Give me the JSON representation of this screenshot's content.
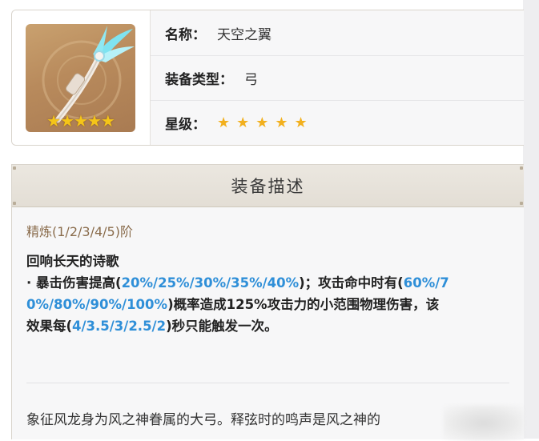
{
  "item": {
    "name_label": "名称：",
    "name_value": "天空之翼",
    "type_label": "装备类型：",
    "type_value": "弓",
    "rarity_label": "星级：",
    "rarity_stars": "★★★★★",
    "thumb_stars": "★★★★★",
    "rarity_count": 5
  },
  "description": {
    "header": "装备描述",
    "refinement": "精炼(1/2/3/4/5)阶",
    "skill_title": "回响长天的诗歌",
    "line1_a": "· 暴击伤害提高(",
    "line1_b": "20%/25%/30%/35%/40%",
    "line1_c": ")；攻击命中时有(",
    "line1_d": "60%/7",
    "line2_a": "0%/80%/90%/100%",
    "line2_b": ")概率造成125%攻击力的小范围物理伤害，该",
    "line3_a": "效果每(",
    "line3_b": "4/3.5/3/2.5/2",
    "line3_c": ")秒只能触发一次。",
    "lore_line1": "象征风龙身为风之神眷属的大弓。释弦时的鸣声是风之神的"
  },
  "colors": {
    "highlight": "#2f8fd8",
    "star": "#f2b01e",
    "refine_text": "#8a6c4c"
  },
  "icons": [
    "bow-weapon-icon",
    "star-icon"
  ]
}
